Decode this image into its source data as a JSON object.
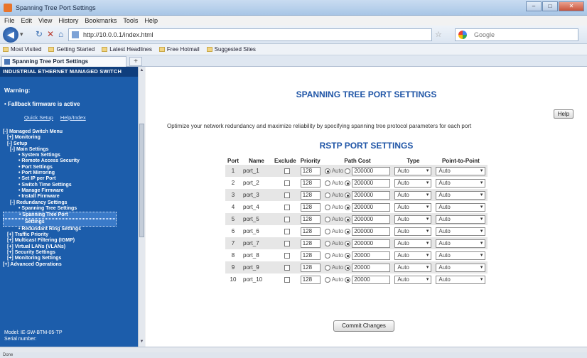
{
  "window": {
    "title": "Spanning Tree Port Settings",
    "controls": [
      "–",
      "□",
      "✕"
    ]
  },
  "menu": [
    "File",
    "Edit",
    "View",
    "History",
    "Bookmarks",
    "Tools",
    "Help"
  ],
  "nav": {
    "url": "http://10.0.0.1/index.html",
    "search_placeholder": "Google",
    "back_icon": "arrow-left-icon"
  },
  "bookmarks": [
    "Most Visited",
    "Getting Started",
    "Latest Headlines",
    "Free Hotmail",
    "Suggested Sites"
  ],
  "tab": {
    "label": "Spanning Tree Port Settings",
    "new_tab": "+"
  },
  "sidebar": {
    "header": "INDUSTRIAL ETHERNET MANAGED SWITCH",
    "warning": "Warning:",
    "fallback": "• Fallback firmware is active",
    "links": [
      "Quick Setup",
      "Help/Index"
    ],
    "tree": [
      {
        "level": 0,
        "label": "[-] Managed Switch Menu"
      },
      {
        "level": 1,
        "label": "[+] Monitoring"
      },
      {
        "level": 1,
        "label": "[-] Setup"
      },
      {
        "level": 2,
        "label": "[-] Main Settings"
      },
      {
        "level": 4,
        "label": "• System Settings"
      },
      {
        "level": 4,
        "label": "• Remote Access Security"
      },
      {
        "level": 4,
        "label": "• Port Settings"
      },
      {
        "level": 4,
        "label": "• Port Mirroring"
      },
      {
        "level": 4,
        "label": "• Set IP per Port"
      },
      {
        "level": 4,
        "label": "• Switch Time Settings"
      },
      {
        "level": 4,
        "label": "• Manage Firmware"
      },
      {
        "level": 4,
        "label": "• Install Firmware"
      },
      {
        "level": 2,
        "label": "[-] Redundancy Settings"
      },
      {
        "level": 4,
        "label": "• Spanning Tree Settings"
      },
      {
        "level": 4,
        "label": "• Spanning Tree Port"
      },
      {
        "level": 5,
        "label": "Settings"
      },
      {
        "level": 4,
        "label": "• Redundant Ring Settings"
      },
      {
        "level": 1,
        "label": "[+] Traffic Priority"
      },
      {
        "level": 1,
        "label": "[+] Multicast Filtering (IGMP)"
      },
      {
        "level": 1,
        "label": "[+] Virtual LANs (VLANs)"
      },
      {
        "level": 1,
        "label": "[+] Security Settings"
      },
      {
        "level": 1,
        "label": "[+] Monitoring Settings"
      },
      {
        "level": 0,
        "label": "[+] Advanced Operations"
      }
    ],
    "footer": [
      "Model:        IE-SW-BTM-05-TP",
      "Serial number:  "
    ]
  },
  "main": {
    "title": "SPANNING TREE PORT SETTINGS",
    "help_label": "Help",
    "description": "Optimize your network redundancy and maximize reliability by specifying spanning tree protocol parameters for each port",
    "subtitle": "RSTP PORT SETTINGS",
    "columns": [
      "Port",
      "Name",
      "Exclude",
      "Priority",
      "Path Cost",
      "Type",
      "Point-to-Point"
    ],
    "auto_label": "Auto",
    "ports": [
      {
        "port": "1",
        "name": "port_1",
        "priority": "128",
        "auto": false,
        "cost": "200000",
        "type": "Auto",
        "p2p": "Auto"
      },
      {
        "port": "2",
        "name": "port_2",
        "priority": "128",
        "auto": true,
        "cost": "200000",
        "type": "Auto",
        "p2p": "Auto"
      },
      {
        "port": "3",
        "name": "port_3",
        "priority": "128",
        "auto": true,
        "cost": "200000",
        "type": "Auto",
        "p2p": "Auto"
      },
      {
        "port": "4",
        "name": "port_4",
        "priority": "128",
        "auto": true,
        "cost": "200000",
        "type": "Auto",
        "p2p": "Auto"
      },
      {
        "port": "5",
        "name": "port_5",
        "priority": "128",
        "auto": true,
        "cost": "200000",
        "type": "Auto",
        "p2p": "Auto"
      },
      {
        "port": "6",
        "name": "port_6",
        "priority": "128",
        "auto": true,
        "cost": "200000",
        "type": "Auto",
        "p2p": "Auto"
      },
      {
        "port": "7",
        "name": "port_7",
        "priority": "128",
        "auto": true,
        "cost": "200000",
        "type": "Auto",
        "p2p": "Auto"
      },
      {
        "port": "8",
        "name": "port_8",
        "priority": "128",
        "auto": true,
        "cost": "20000",
        "type": "Auto",
        "p2p": "Auto"
      },
      {
        "port": "9",
        "name": "port_9",
        "priority": "128",
        "auto": true,
        "cost": "20000",
        "type": "Auto",
        "p2p": "Auto"
      },
      {
        "port": "10",
        "name": "port_10",
        "priority": "128",
        "auto": true,
        "cost": "20000",
        "type": "Auto",
        "p2p": "Auto"
      }
    ],
    "commit_label": "Commit Changes"
  },
  "status": "Done"
}
